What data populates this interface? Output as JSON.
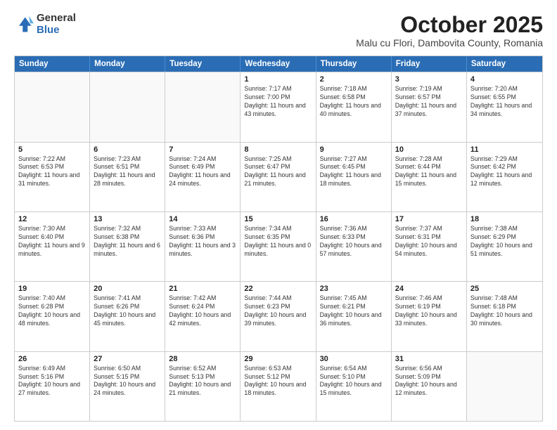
{
  "logo": {
    "general": "General",
    "blue": "Blue"
  },
  "title": {
    "month": "October 2025",
    "location": "Malu cu Flori, Dambovita County, Romania"
  },
  "headers": [
    "Sunday",
    "Monday",
    "Tuesday",
    "Wednesday",
    "Thursday",
    "Friday",
    "Saturday"
  ],
  "rows": [
    [
      {
        "day": "",
        "info": ""
      },
      {
        "day": "",
        "info": ""
      },
      {
        "day": "",
        "info": ""
      },
      {
        "day": "1",
        "info": "Sunrise: 7:17 AM\nSunset: 7:00 PM\nDaylight: 11 hours and 43 minutes."
      },
      {
        "day": "2",
        "info": "Sunrise: 7:18 AM\nSunset: 6:58 PM\nDaylight: 11 hours and 40 minutes."
      },
      {
        "day": "3",
        "info": "Sunrise: 7:19 AM\nSunset: 6:57 PM\nDaylight: 11 hours and 37 minutes."
      },
      {
        "day": "4",
        "info": "Sunrise: 7:20 AM\nSunset: 6:55 PM\nDaylight: 11 hours and 34 minutes."
      }
    ],
    [
      {
        "day": "5",
        "info": "Sunrise: 7:22 AM\nSunset: 6:53 PM\nDaylight: 11 hours and 31 minutes."
      },
      {
        "day": "6",
        "info": "Sunrise: 7:23 AM\nSunset: 6:51 PM\nDaylight: 11 hours and 28 minutes."
      },
      {
        "day": "7",
        "info": "Sunrise: 7:24 AM\nSunset: 6:49 PM\nDaylight: 11 hours and 24 minutes."
      },
      {
        "day": "8",
        "info": "Sunrise: 7:25 AM\nSunset: 6:47 PM\nDaylight: 11 hours and 21 minutes."
      },
      {
        "day": "9",
        "info": "Sunrise: 7:27 AM\nSunset: 6:45 PM\nDaylight: 11 hours and 18 minutes."
      },
      {
        "day": "10",
        "info": "Sunrise: 7:28 AM\nSunset: 6:44 PM\nDaylight: 11 hours and 15 minutes."
      },
      {
        "day": "11",
        "info": "Sunrise: 7:29 AM\nSunset: 6:42 PM\nDaylight: 11 hours and 12 minutes."
      }
    ],
    [
      {
        "day": "12",
        "info": "Sunrise: 7:30 AM\nSunset: 6:40 PM\nDaylight: 11 hours and 9 minutes."
      },
      {
        "day": "13",
        "info": "Sunrise: 7:32 AM\nSunset: 6:38 PM\nDaylight: 11 hours and 6 minutes."
      },
      {
        "day": "14",
        "info": "Sunrise: 7:33 AM\nSunset: 6:36 PM\nDaylight: 11 hours and 3 minutes."
      },
      {
        "day": "15",
        "info": "Sunrise: 7:34 AM\nSunset: 6:35 PM\nDaylight: 11 hours and 0 minutes."
      },
      {
        "day": "16",
        "info": "Sunrise: 7:36 AM\nSunset: 6:33 PM\nDaylight: 10 hours and 57 minutes."
      },
      {
        "day": "17",
        "info": "Sunrise: 7:37 AM\nSunset: 6:31 PM\nDaylight: 10 hours and 54 minutes."
      },
      {
        "day": "18",
        "info": "Sunrise: 7:38 AM\nSunset: 6:29 PM\nDaylight: 10 hours and 51 minutes."
      }
    ],
    [
      {
        "day": "19",
        "info": "Sunrise: 7:40 AM\nSunset: 6:28 PM\nDaylight: 10 hours and 48 minutes."
      },
      {
        "day": "20",
        "info": "Sunrise: 7:41 AM\nSunset: 6:26 PM\nDaylight: 10 hours and 45 minutes."
      },
      {
        "day": "21",
        "info": "Sunrise: 7:42 AM\nSunset: 6:24 PM\nDaylight: 10 hours and 42 minutes."
      },
      {
        "day": "22",
        "info": "Sunrise: 7:44 AM\nSunset: 6:23 PM\nDaylight: 10 hours and 39 minutes."
      },
      {
        "day": "23",
        "info": "Sunrise: 7:45 AM\nSunset: 6:21 PM\nDaylight: 10 hours and 36 minutes."
      },
      {
        "day": "24",
        "info": "Sunrise: 7:46 AM\nSunset: 6:19 PM\nDaylight: 10 hours and 33 minutes."
      },
      {
        "day": "25",
        "info": "Sunrise: 7:48 AM\nSunset: 6:18 PM\nDaylight: 10 hours and 30 minutes."
      }
    ],
    [
      {
        "day": "26",
        "info": "Sunrise: 6:49 AM\nSunset: 5:16 PM\nDaylight: 10 hours and 27 minutes."
      },
      {
        "day": "27",
        "info": "Sunrise: 6:50 AM\nSunset: 5:15 PM\nDaylight: 10 hours and 24 minutes."
      },
      {
        "day": "28",
        "info": "Sunrise: 6:52 AM\nSunset: 5:13 PM\nDaylight: 10 hours and 21 minutes."
      },
      {
        "day": "29",
        "info": "Sunrise: 6:53 AM\nSunset: 5:12 PM\nDaylight: 10 hours and 18 minutes."
      },
      {
        "day": "30",
        "info": "Sunrise: 6:54 AM\nSunset: 5:10 PM\nDaylight: 10 hours and 15 minutes."
      },
      {
        "day": "31",
        "info": "Sunrise: 6:56 AM\nSunset: 5:09 PM\nDaylight: 10 hours and 12 minutes."
      },
      {
        "day": "",
        "info": ""
      }
    ]
  ]
}
